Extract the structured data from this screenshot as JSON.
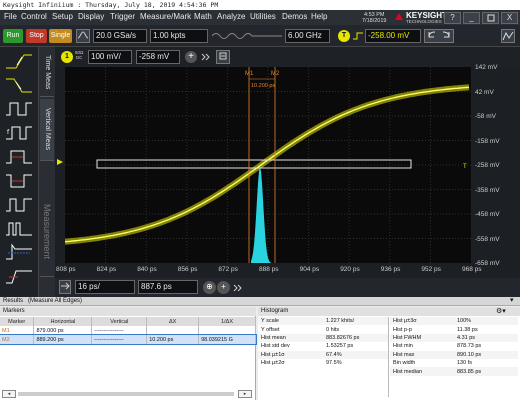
{
  "window": {
    "title": "Keysight Infiniium : Thursday, July 18, 2019 4:54:36 PM"
  },
  "menu": [
    "File",
    "Control",
    "Setup",
    "Display",
    "Trigger",
    "Measure/Mark",
    "Math",
    "Analyze",
    "Utilities",
    "Demos",
    "Help"
  ],
  "clock": {
    "time": "4:53 PM",
    "date": "7/18/2019"
  },
  "brand": {
    "name": "KEYSIGHT",
    "sub": "TECHNOLOGIES"
  },
  "window_controls": {
    "help": "?",
    "minimize": "_",
    "close": "X"
  },
  "controls": {
    "run": "Run",
    "stop": "Stop",
    "single": "Single",
    "sample_rate": "20.0 GSa/s",
    "memory_depth": "1.00 kpts",
    "bandwidth": "6.00 GHz",
    "trigger_badge": "T",
    "trigger_level": "-258.00 mV",
    "run_color": "#2a9a2a",
    "stop_color": "#c0392b",
    "single_color": "#c58a1e"
  },
  "channel": {
    "number": "1",
    "impedance": "50Ω",
    "coupling": "DC",
    "scale": "100 mV/",
    "offset": "-258 mV",
    "color": "#e6e600"
  },
  "vertical_tabs": [
    "Time Meas",
    "Vertical Meas",
    "Measurement"
  ],
  "plot": {
    "y_ticks": [
      "142 mV",
      "42 mV",
      "-58 mV",
      "-158 mV",
      "-258 mV",
      "-358 mV",
      "-458 mV",
      "-558 mV",
      "-658 mV"
    ],
    "x_ticks": [
      "808 ps",
      "824 ps",
      "840 ps",
      "856 ps",
      "872 ps",
      "888 ps",
      "904 ps",
      "920 ps",
      "936 ps",
      "952 ps",
      "968 ps"
    ],
    "marker_labels": [
      "M1",
      "M2"
    ],
    "marker_delta": "10.200 ps",
    "trigger_marker": "T",
    "histogram_color": "#29d3e0",
    "marker_color": "#e8852a"
  },
  "timebase": {
    "scale": "16 ps/",
    "position": "887.6 ps"
  },
  "results": {
    "title": "Results",
    "subtitle": "(Measure All Edges)",
    "markers_title": "Markers",
    "marker_columns": [
      "Marker",
      "Horizontal",
      "Vertical",
      "ΔX",
      "1/ΔX"
    ],
    "marker_rows": [
      {
        "name": "M1",
        "horizontal": "879.000 ps",
        "vertical": "----------------",
        "dx": "",
        "inv_dx": ""
      },
      {
        "name": "M2",
        "horizontal": "889.200 ps",
        "vertical": "----------------",
        "dx": "10.200 ps",
        "inv_dx": "98.039215 G"
      }
    ],
    "histogram_title": "Histogram",
    "hist_left": [
      [
        "Y scale",
        "1.227 khits/"
      ],
      [
        "Y offset",
        "0 hits"
      ],
      [
        "Hist mean",
        "883.82676 ps"
      ],
      [
        "Hist std dev",
        "1.53257 ps"
      ],
      [
        "Hist μ±1σ",
        "67.4%"
      ],
      [
        "Hist μ±2σ",
        "97.5%"
      ]
    ],
    "hist_right": [
      [
        "Hist μ±3σ",
        "100%"
      ],
      [
        "Hist p-p",
        "11.38 ps"
      ],
      [
        "Hist FWHM",
        "4.31 ps"
      ],
      [
        "Hist min",
        "878.73 ps"
      ],
      [
        "Hist max",
        "890.10 ps"
      ],
      [
        "Bin width",
        "130 fs"
      ],
      [
        "Hist median",
        "883.85 ps"
      ]
    ]
  }
}
